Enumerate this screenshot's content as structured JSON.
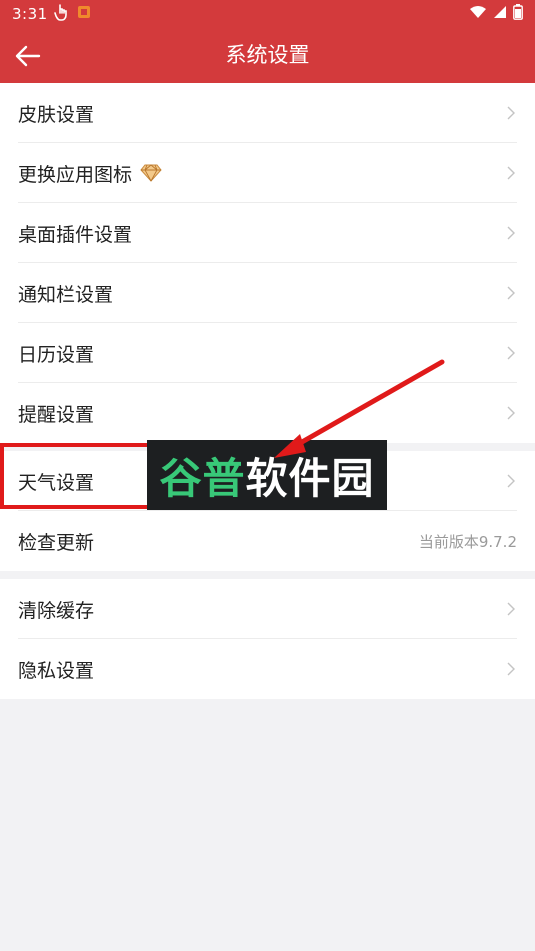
{
  "status_bar": {
    "time": "3:31"
  },
  "app_bar": {
    "title": "系统设置"
  },
  "groups": [
    {
      "items": [
        {
          "label": "皮肤设置"
        },
        {
          "label": "更换应用图标"
        },
        {
          "label": "桌面插件设置"
        },
        {
          "label": "通知栏设置"
        },
        {
          "label": "日历设置"
        },
        {
          "label": "提醒设置"
        }
      ]
    },
    {
      "items": [
        {
          "label": "天气设置"
        },
        {
          "label": "检查更新",
          "value": "当前版本9.7.2"
        }
      ]
    },
    {
      "items": [
        {
          "label": "清除缓存"
        },
        {
          "label": "隐私设置"
        }
      ]
    }
  ],
  "watermark": {
    "part1": "谷普",
    "part2": "软件园"
  },
  "colors": {
    "brand_red": "#d33a3c",
    "highlight_red": "#e01a1a"
  }
}
